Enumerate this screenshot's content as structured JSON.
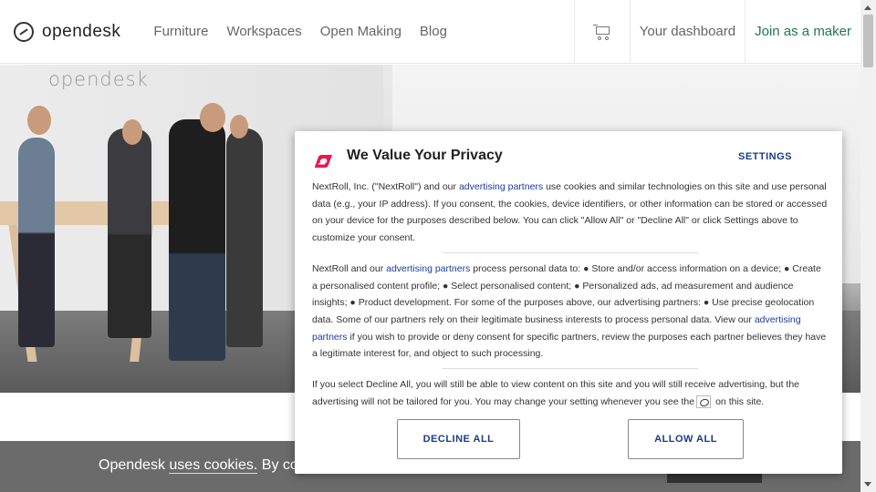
{
  "header": {
    "brand": "opendesk",
    "nav": [
      "Furniture",
      "Workspaces",
      "Open Making",
      "Blog"
    ],
    "dashboard": "Your dashboard",
    "join": "Join as a maker",
    "cart_icon": "shopping-cart-icon"
  },
  "hero": {
    "logo_text": "opendesk"
  },
  "cookie_bar": {
    "prefix": "Opendesk",
    "link": "uses cookies.",
    "suffix": "By co"
  },
  "privacy_modal": {
    "title": "We Value Your Privacy",
    "settings": "SETTINGS",
    "p1_a": "NextRoll, Inc. (\"NextRoll\") and our ",
    "p1_link": "advertising partners",
    "p1_b": " use cookies and similar technologies on this site and use personal data (e.g., your IP address). If you consent, the cookies, device identifiers, or other information can be stored or accessed on your device for the purposes described below. You can click \"Allow All\" or \"Decline All\" or click Settings above to customize your consent.",
    "p2_a": "NextRoll and our ",
    "p2_link1": "advertising partners",
    "p2_b": " process personal data to: ● Store and/or access information on a device; ● Create a personalised content profile; ● Select personalised content; ● Personalized ads, ad measurement and audience insights; ● Product development. For some of the purposes above, our advertising partners: ● Use precise geolocation data. Some of our partners rely on their legitimate business interests to process personal data. View our ",
    "p2_link2": "advertising partners",
    "p2_c": " if you wish to provide or deny consent for specific partners, review the purposes each partner believes they have a legitimate interest for, and object to such processing.",
    "p3_a": "If you select Decline All, you will still be able to view content on this site and you will still receive advertising, but the advertising will not be tailored for you. You may change your setting whenever you see the",
    "p3_b": "on this site.",
    "decline": "DECLINE ALL",
    "allow": "ALLOW ALL",
    "brand_color": "#e8174f"
  }
}
